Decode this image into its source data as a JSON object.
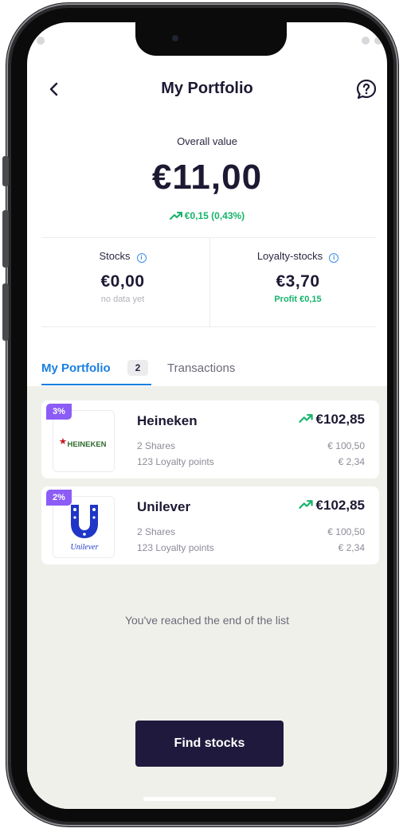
{
  "header": {
    "title": "My Portfolio"
  },
  "overall": {
    "label": "Overall value",
    "value": "€11,00",
    "change": "€0,15 (0,43%)"
  },
  "stats": {
    "stocks": {
      "label": "Stocks",
      "value": "€0,00",
      "sub": "no data yet"
    },
    "loyalty": {
      "label": "Loyalty-stocks",
      "value": "€3,70",
      "sub": "Profit €0,15"
    }
  },
  "tabs": {
    "portfolio": {
      "label": "My Portfolio",
      "count": "2"
    },
    "transactions": {
      "label": "Transactions"
    }
  },
  "holdings": [
    {
      "badge": "3%",
      "logo_text": "HEINEKEN",
      "name": "Heineken",
      "shares": "2 Shares",
      "points": "123 Loyalty points",
      "total": "€102,85",
      "share_value": "€ 100,50",
      "point_value": "€ 2,34"
    },
    {
      "badge": "2%",
      "logo_text": "Unilever",
      "name": "Unilever",
      "shares": "2 Shares",
      "points": "123 Loyalty points",
      "total": "€102,85",
      "share_value": "€ 100,50",
      "point_value": "€ 2,34"
    }
  ],
  "end_message": "You've reached the end of the list",
  "cta": {
    "label": "Find stocks"
  },
  "colors": {
    "primary": "#1f1a3d",
    "accent_blue": "#1a7fe0",
    "positive_green": "#16b36b",
    "badge_purple": "#8b5cf6",
    "list_background": "#f0f0eb"
  },
  "icons": {
    "back": "chevron-left-icon",
    "help": "help-question-icon",
    "info": "info-icon",
    "trend": "trending-up-icon"
  }
}
